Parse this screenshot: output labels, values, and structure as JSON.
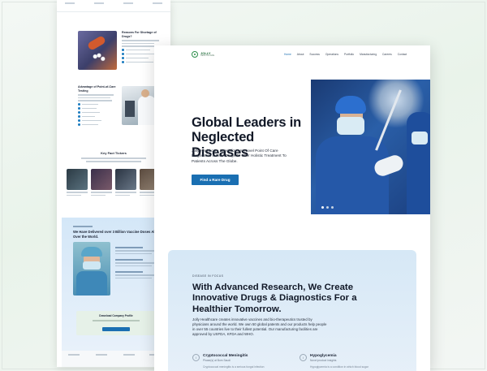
{
  "left_preview": {
    "section1_title": "Reasons For Shortage of Drugs?",
    "section2_title": "Advantage of Point-of-Care Testing",
    "section3_title": "Key Fact Tickers",
    "section4_title": "We Have Delivered over 3 Billion Vaccine Doses All Over the World.",
    "download_title": "Download Company Profile"
  },
  "main_preview": {
    "logo": {
      "name": "JOLLY",
      "sub": "HEALTHCARE"
    },
    "nav": [
      "Home",
      "About",
      "Success",
      "Operations",
      "Portfolio",
      "Manufacturing",
      "Careers",
      "Contact"
    ],
    "nav_active": "Home",
    "hero": {
      "title": "Global Leaders in Neglected Diseases",
      "body": "Jolly Healthcare Specializes In Novel Point Of Care Diagnostics & Rare Drugs To Offer Holistic Treatment To Patients Across The Globe.",
      "button": "Find a Rare Drug",
      "carousel_dots": 3,
      "carousel_active": 1
    },
    "focus": {
      "tag": "DISEASE IN FOCUS",
      "heading": "With Advanced Research, We Create Innovative Drugs & Diagnostics For a Healthier Tomorrow.",
      "body": "Jolly Healthcare creates innovative vaccines and bio-therapeutics trusted by physicians around the world. We own 50 global patents and our products help people in over 55 countries live to their fullest potential. Our manufacturing facilities are approved by USFDA, KFDA and WHO.",
      "items": [
        {
          "name": "Cryptococcal Meningitis",
          "sub": "Phase(s) at Bom Saudi",
          "desc": "Cryptococcal meningitis is a serious fungal infection"
        },
        {
          "name": "Hypoglycemia",
          "sub": "Novel product insights",
          "desc": "Hypoglycemia is a condition in which blood sugar"
        }
      ]
    }
  },
  "colors": {
    "accent": "#1a6fb2",
    "brand_green": "#2c8e4a",
    "card_bg": "#d6e8f6"
  }
}
